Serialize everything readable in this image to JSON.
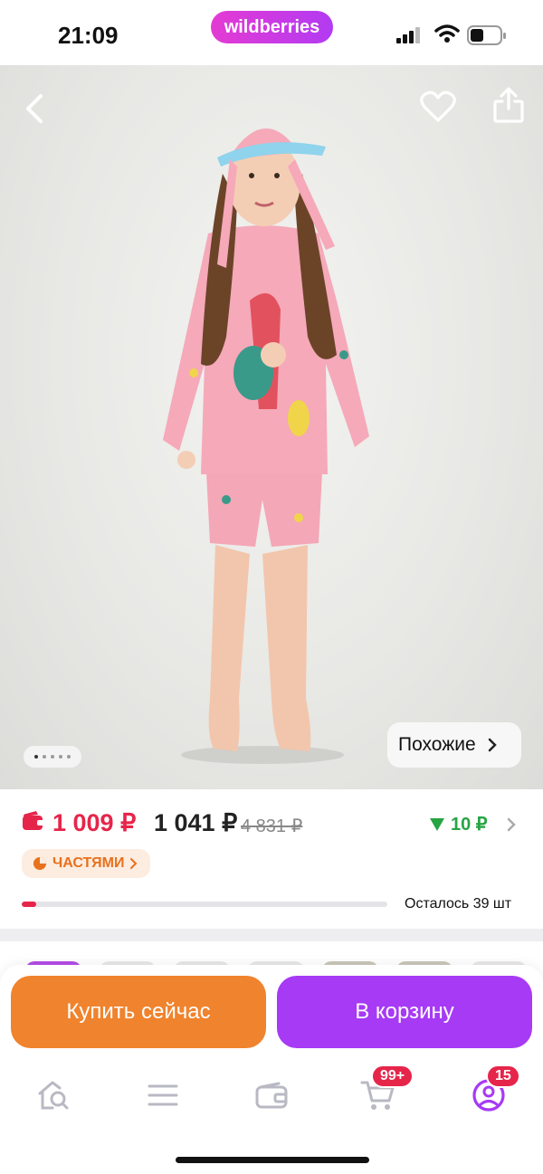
{
  "status": {
    "time": "21:09",
    "brand": "wildberries"
  },
  "photo": {
    "similar_label": "Похожие",
    "image_count": 5,
    "active_index": 0
  },
  "price": {
    "wallet_price": "1 009 ₽",
    "price": "1 041 ₽",
    "old_price": "4 831 ₽",
    "cashback": "10 ₽",
    "installments_label": "ЧАСТЯМИ",
    "stock_text": "Осталось 39 шт",
    "stock_fill": 0.04
  },
  "actions": {
    "buy_now": "Купить сейчас",
    "add_to_cart": "В корзину"
  },
  "tabbar": {
    "cart_badge": "99+",
    "profile_badge": "15"
  },
  "colors": {
    "accent_purple": "#a73af5",
    "accent_orange": "#f0832d",
    "price_red": "#e6254a",
    "cashback_green": "#27a444"
  }
}
